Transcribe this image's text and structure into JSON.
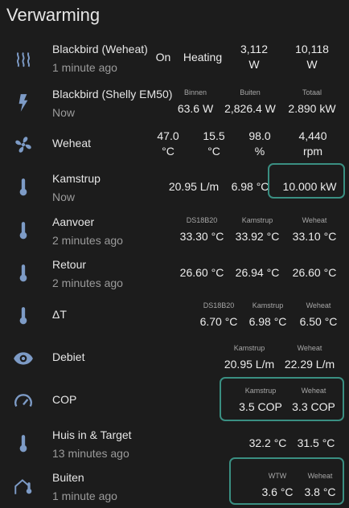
{
  "title": "Verwarming",
  "rows": [
    {
      "name": "Blackbird (Weheat)",
      "sub": "1 minute ago",
      "icon": "heat-waves-icon",
      "cells": [
        {
          "l": "",
          "v": "On"
        },
        {
          "l": "",
          "v": "Heating"
        },
        {
          "l": "",
          "v": "3,112\nW"
        },
        {
          "l": "",
          "v": "10,118\nW"
        }
      ]
    },
    {
      "name": "Blackbird (Shelly EM50)",
      "sub": "Now",
      "icon": "flash-icon",
      "cells": [
        {
          "l": "Binnen",
          "v": "63.6 W"
        },
        {
          "l": "Buiten",
          "v": "2,826.4 W"
        },
        {
          "l": "Totaal",
          "v": "2.890 kW"
        }
      ]
    },
    {
      "name": "Weheat",
      "sub": "",
      "icon": "fan-icon",
      "cells": [
        {
          "l": "",
          "v": "47.0\n°C"
        },
        {
          "l": "",
          "v": "15.5\n°C"
        },
        {
          "l": "",
          "v": "98.0\n%"
        },
        {
          "l": "",
          "v": "4,440\nrpm"
        }
      ]
    },
    {
      "name": "Kamstrup",
      "sub": "Now",
      "icon": "thermometer-icon",
      "cells": [
        {
          "l": "",
          "v": "20.95 L/m"
        },
        {
          "l": "",
          "v": "6.98 °C"
        },
        {
          "l": "",
          "v": "10.000 kW"
        }
      ]
    },
    {
      "name": "Aanvoer",
      "sub": "2 minutes ago",
      "icon": "thermometer-icon",
      "cells": [
        {
          "l": "DS18B20",
          "v": "33.30 °C"
        },
        {
          "l": "Kamstrup",
          "v": "33.92 °C"
        },
        {
          "l": "Weheat",
          "v": "33.10 °C"
        }
      ]
    },
    {
      "name": "Retour",
      "sub": "2 minutes ago",
      "icon": "thermometer-icon",
      "cells": [
        {
          "l": "",
          "v": "26.60 °C"
        },
        {
          "l": "",
          "v": "26.94 °C"
        },
        {
          "l": "",
          "v": "26.60 °C"
        }
      ]
    },
    {
      "name": "ΔT",
      "sub": "",
      "icon": "thermometer-icon",
      "cells": [
        {
          "l": "DS18B20",
          "v": "6.70 °C"
        },
        {
          "l": "Kamstrup",
          "v": "6.98 °C"
        },
        {
          "l": "Weheat",
          "v": "6.50 °C"
        }
      ]
    },
    {
      "name": "Debiet",
      "sub": "",
      "icon": "eye-icon",
      "cells": [
        {
          "l": "Kamstrup",
          "v": "20.95 L/m"
        },
        {
          "l": "Weheat",
          "v": "22.29 L/m"
        }
      ]
    },
    {
      "name": "COP",
      "sub": "",
      "icon": "gauge-icon",
      "cells": [
        {
          "l": "Kamstrup",
          "v": "3.5 COP"
        },
        {
          "l": "Weheat",
          "v": "3.3 COP"
        }
      ]
    },
    {
      "name": "Huis in & Target",
      "sub": "13 minutes ago",
      "icon": "thermometer-icon",
      "cells": [
        {
          "l": "",
          "v": "32.2 °C"
        },
        {
          "l": "",
          "v": "31.5 °C"
        }
      ]
    },
    {
      "name": "Buiten",
      "sub": "1 minute ago",
      "icon": "home-thermometer-icon",
      "cells": [
        {
          "l": "WTW",
          "v": "3.6 °C"
        },
        {
          "l": "Weheat",
          "v": "3.8 °C"
        }
      ]
    }
  ],
  "colors": {
    "background": "#1c1c1c",
    "icon": "#7d9bc6",
    "highlight": "#3a8f82"
  }
}
